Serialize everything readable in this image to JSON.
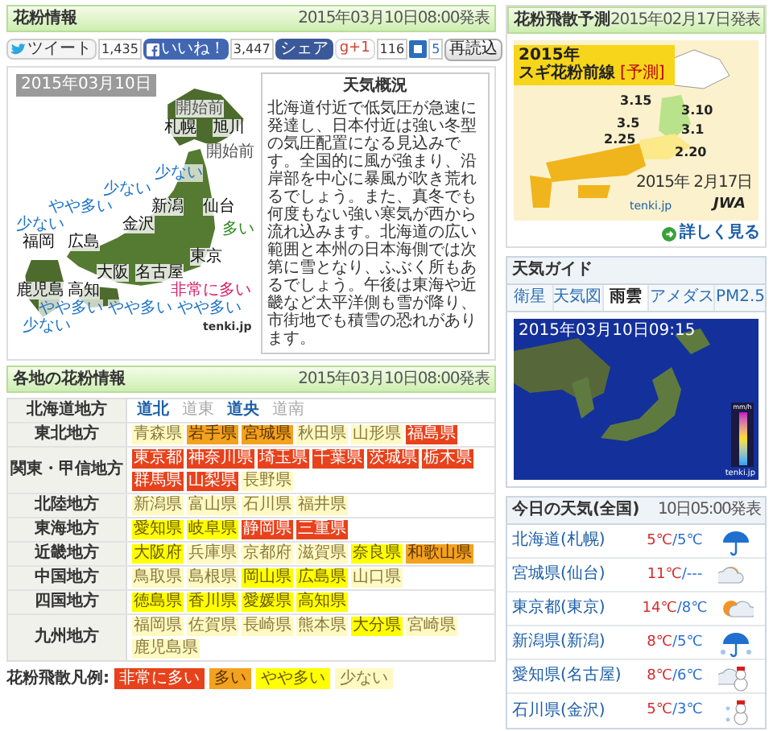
{
  "header": {
    "title": "花粉情報",
    "published": "2015年03月10日08:00発表"
  },
  "social": {
    "tweet": "ツイート",
    "tweet_count": "1,435",
    "like": "いいね！",
    "like_count": "3,447",
    "share": "シェア",
    "gplus": "g+1",
    "gplus_count": "116",
    "bookmark_count": "5",
    "reload": "再読込"
  },
  "pollen_map": {
    "date": "2015年03月10日",
    "credit": "tenki.jp",
    "labels": [
      {
        "text": "開始前",
        "kind": "start"
      },
      {
        "text": "札幌",
        "kind": "city"
      },
      {
        "text": "旭川",
        "kind": "city"
      },
      {
        "text": "開始前",
        "kind": "start"
      },
      {
        "text": "少ない",
        "kind": "low"
      },
      {
        "text": "少ない",
        "kind": "low"
      },
      {
        "text": "やや多い",
        "kind": "medium"
      },
      {
        "text": "新潟",
        "kind": "city"
      },
      {
        "text": "仙台",
        "kind": "city"
      },
      {
        "text": "少ない",
        "kind": "low"
      },
      {
        "text": "金沢",
        "kind": "city"
      },
      {
        "text": "福岡",
        "kind": "city"
      },
      {
        "text": "広島",
        "kind": "city"
      },
      {
        "text": "多い",
        "kind": "high"
      },
      {
        "text": "東京",
        "kind": "city"
      },
      {
        "text": "大阪",
        "kind": "city"
      },
      {
        "text": "名古屋",
        "kind": "city"
      },
      {
        "text": "鹿児島",
        "kind": "city"
      },
      {
        "text": "高知",
        "kind": "city"
      },
      {
        "text": "非常に多い",
        "kind": "very_high"
      },
      {
        "text": "やや多い",
        "kind": "medium"
      },
      {
        "text": "やや多い",
        "kind": "medium"
      },
      {
        "text": "やや多い",
        "kind": "medium"
      },
      {
        "text": "少ない",
        "kind": "low"
      }
    ]
  },
  "summary": {
    "title": "天気概況",
    "text": "北海道付近で低気圧が急速に発達し、日本付近は強い冬型の気圧配置になる見込みです。全国的に風が強まり、沿岸部を中心に暴風が吹き荒れるでしょう。また、真冬でも何度もない強い寒気が西から流れ込みます。北海道の広い範囲と本州の日本海側では次第に雪となり、ふぶく所もあるでしょう。午後は東海や近畿など太平洋側も雪が降り、市街地でも積雪の恐れがあります。"
  },
  "regional": {
    "title": "各地の花粉情報",
    "published": "2015年03月10日08:00発表",
    "regions": [
      {
        "name": "北海道地方",
        "areas": [
          {
            "name": "道北",
            "active": true
          },
          {
            "name": "道東",
            "active": false
          },
          {
            "name": "道央",
            "active": true
          },
          {
            "name": "道南",
            "active": false
          }
        ]
      },
      {
        "name": "東北地方",
        "prefectures": [
          {
            "name": "青森県",
            "kind": "low"
          },
          {
            "name": "岩手県",
            "kind": "high"
          },
          {
            "name": "宮城県",
            "kind": "high"
          },
          {
            "name": "秋田県",
            "kind": "low"
          },
          {
            "name": "山形県",
            "kind": "low"
          },
          {
            "name": "福島県",
            "kind": "very_high"
          }
        ]
      },
      {
        "name": "関東・甲信地方",
        "prefectures": [
          {
            "name": "東京都",
            "kind": "very_high"
          },
          {
            "name": "神奈川県",
            "kind": "very_high"
          },
          {
            "name": "埼玉県",
            "kind": "very_high"
          },
          {
            "name": "千葉県",
            "kind": "very_high"
          },
          {
            "name": "茨城県",
            "kind": "very_high"
          },
          {
            "name": "栃木県",
            "kind": "very_high"
          },
          {
            "name": "群馬県",
            "kind": "very_high"
          },
          {
            "name": "山梨県",
            "kind": "very_high"
          },
          {
            "name": "長野県",
            "kind": "low"
          }
        ]
      },
      {
        "name": "北陸地方",
        "prefectures": [
          {
            "name": "新潟県",
            "kind": "low"
          },
          {
            "name": "富山県",
            "kind": "low"
          },
          {
            "name": "石川県",
            "kind": "low"
          },
          {
            "name": "福井県",
            "kind": "low"
          }
        ]
      },
      {
        "name": "東海地方",
        "prefectures": [
          {
            "name": "愛知県",
            "kind": "medium"
          },
          {
            "name": "岐阜県",
            "kind": "medium"
          },
          {
            "name": "静岡県",
            "kind": "very_high"
          },
          {
            "name": "三重県",
            "kind": "very_high"
          }
        ]
      },
      {
        "name": "近畿地方",
        "prefectures": [
          {
            "name": "大阪府",
            "kind": "medium"
          },
          {
            "name": "兵庫県",
            "kind": "low"
          },
          {
            "name": "京都府",
            "kind": "low"
          },
          {
            "name": "滋賀県",
            "kind": "low"
          },
          {
            "name": "奈良県",
            "kind": "medium"
          },
          {
            "name": "和歌山県",
            "kind": "high"
          }
        ]
      },
      {
        "name": "中国地方",
        "prefectures": [
          {
            "name": "鳥取県",
            "kind": "low"
          },
          {
            "name": "島根県",
            "kind": "low"
          },
          {
            "name": "岡山県",
            "kind": "medium"
          },
          {
            "name": "広島県",
            "kind": "medium"
          },
          {
            "name": "山口県",
            "kind": "low"
          }
        ]
      },
      {
        "name": "四国地方",
        "prefectures": [
          {
            "name": "徳島県",
            "kind": "medium"
          },
          {
            "name": "香川県",
            "kind": "medium"
          },
          {
            "name": "愛媛県",
            "kind": "medium"
          },
          {
            "name": "高知県",
            "kind": "medium"
          }
        ]
      },
      {
        "name": "九州地方",
        "prefectures": [
          {
            "name": "福岡県",
            "kind": "low"
          },
          {
            "name": "佐賀県",
            "kind": "low"
          },
          {
            "name": "長崎県",
            "kind": "low"
          },
          {
            "name": "熊本県",
            "kind": "low"
          },
          {
            "name": "大分県",
            "kind": "medium"
          },
          {
            "name": "宮崎県",
            "kind": "low"
          },
          {
            "name": "鹿児島県",
            "kind": "low"
          }
        ]
      }
    ]
  },
  "legend": {
    "title": "花粉飛散凡例:",
    "items": [
      {
        "label": "非常に多い",
        "kind": "very_high"
      },
      {
        "label": "多い",
        "kind": "high"
      },
      {
        "label": "やや多い",
        "kind": "medium"
      },
      {
        "label": "少ない",
        "kind": "low"
      }
    ]
  },
  "forecast": {
    "title": "花粉飛散予測",
    "published": "2015年02月17日発表",
    "banner_year": "2015年",
    "banner_title": "スギ花粉前線",
    "banner_tag": "[予測]",
    "dates": [
      "3.15",
      "3.10",
      "3.5",
      "3.1",
      "2.25",
      "2.20"
    ],
    "issued": "2015年 2月17日",
    "credit": "tenki.jp",
    "agency": "JWA",
    "more": "詳しく見る"
  },
  "guide": {
    "title": "天気ガイド",
    "tabs": [
      {
        "label": "衛星",
        "selected": false
      },
      {
        "label": "天気図",
        "selected": false
      },
      {
        "label": "雨雲",
        "selected": true
      },
      {
        "label": "アメダス",
        "selected": false
      },
      {
        "label": "PM2.5",
        "selected": false
      }
    ],
    "timestamp": "2015年03月10日09:15",
    "unit": "mm/h",
    "credit": "tenki.jp"
  },
  "today": {
    "title": "今日の天気(全国)",
    "published": "10日05:00発表",
    "rows": [
      {
        "city": "北海道(札幌)",
        "high": "5℃",
        "low": "/5℃",
        "kind": "rain"
      },
      {
        "city": "宮城県(仙台)",
        "high": "11℃",
        "low": "/---",
        "kind": "cloud_sun"
      },
      {
        "city": "東京都(東京)",
        "high": "14℃",
        "low": "/8℃",
        "kind": "sun_cloud"
      },
      {
        "city": "新潟県(新潟)",
        "high": "8℃",
        "low": "/5℃",
        "kind": "rain_snow"
      },
      {
        "city": "愛知県(名古屋)",
        "high": "8℃",
        "low": "/6℃",
        "kind": "cloud_snow"
      },
      {
        "city": "石川県(金沢)",
        "high": "5℃",
        "low": "/3℃",
        "kind": "snow"
      }
    ]
  }
}
